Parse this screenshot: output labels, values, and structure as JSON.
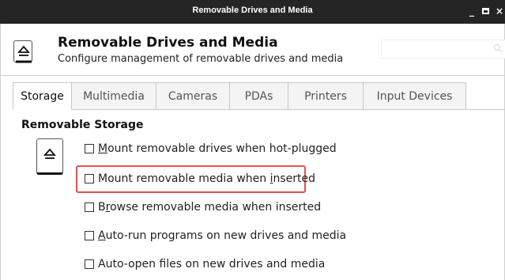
{
  "window": {
    "title": "Removable Drives and Media",
    "minimize_glyph": "_",
    "close_glyph": "×"
  },
  "header": {
    "icon": "eject-icon",
    "title": "Removable Drives and Media",
    "subtitle": "Configure management of removable drives and media",
    "search_placeholder": ""
  },
  "tabs": [
    {
      "label": "Storage",
      "active": true
    },
    {
      "label": "Multimedia",
      "active": false
    },
    {
      "label": "Cameras",
      "active": false
    },
    {
      "label": "PDAs",
      "active": false
    },
    {
      "label": "Printers",
      "active": false
    },
    {
      "label": "Input Devices",
      "active": false
    }
  ],
  "section": {
    "title": "Removable Storage",
    "icon": "eject-icon"
  },
  "options": [
    {
      "pre": "",
      "mnemonic": "M",
      "post": "ount removable drives when hot-plugged",
      "checked": false
    },
    {
      "pre": "Mount removable media when ",
      "mnemonic": "i",
      "post": "nserted",
      "checked": false,
      "highlighted": true
    },
    {
      "pre": "B",
      "mnemonic": "r",
      "post": "owse removable media when inserted",
      "checked": false
    },
    {
      "pre": "",
      "mnemonic": "A",
      "post": "uto-run programs on new drives and media",
      "checked": false
    },
    {
      "pre": "Auto-open files on new drives and media",
      "mnemonic": "",
      "post": "",
      "checked": false
    }
  ],
  "colors": {
    "titlebar": "#252525",
    "highlight": "#e05252"
  }
}
